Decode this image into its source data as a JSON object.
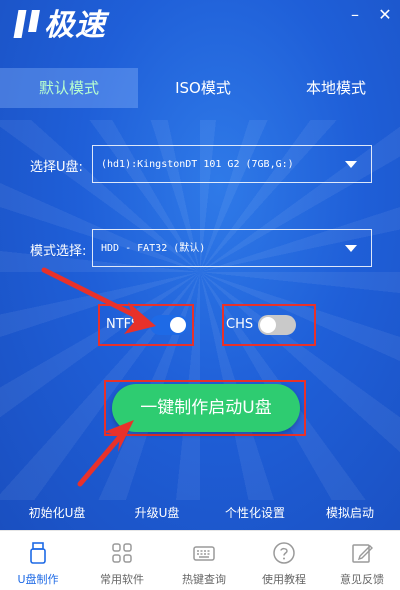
{
  "app": {
    "logo_text": "极速",
    "minimize_icon": "minimize-icon",
    "close_icon": "close-icon"
  },
  "tabs": [
    {
      "label": "默认模式",
      "active": true
    },
    {
      "label": "ISO模式",
      "active": false
    },
    {
      "label": "本地模式",
      "active": false
    }
  ],
  "usb": {
    "label": "选择U盘:",
    "value": "(hd1):KingstonDT 101 G2      (7GB,G:)"
  },
  "mode": {
    "label": "模式选择:",
    "value": "HDD - FAT32 (默认)"
  },
  "options": {
    "ntfs": {
      "label": "NTFS",
      "enabled": true
    },
    "chs": {
      "label": "CHS",
      "enabled": false
    }
  },
  "main_button": {
    "label": "一键制作启动U盘"
  },
  "actions": [
    {
      "label": "初始化U盘"
    },
    {
      "label": "升级U盘"
    },
    {
      "label": "个性化设置"
    },
    {
      "label": "模拟启动"
    }
  ],
  "nav": [
    {
      "label": "U盘制作",
      "icon": "usb-drive-icon",
      "active": true
    },
    {
      "label": "常用软件",
      "icon": "apps-grid-icon",
      "active": false
    },
    {
      "label": "热键查询",
      "icon": "keyboard-icon",
      "active": false
    },
    {
      "label": "使用教程",
      "icon": "help-icon",
      "active": false
    },
    {
      "label": "意见反馈",
      "icon": "feedback-edit-icon",
      "active": false
    }
  ],
  "colors": {
    "accent_blue": "#1f5fd8",
    "active_tab_text": "#b8ffcf",
    "primary_green": "#2ecc71",
    "annotation_red": "#e8312a",
    "toggle_on": "#1e6ae6"
  }
}
